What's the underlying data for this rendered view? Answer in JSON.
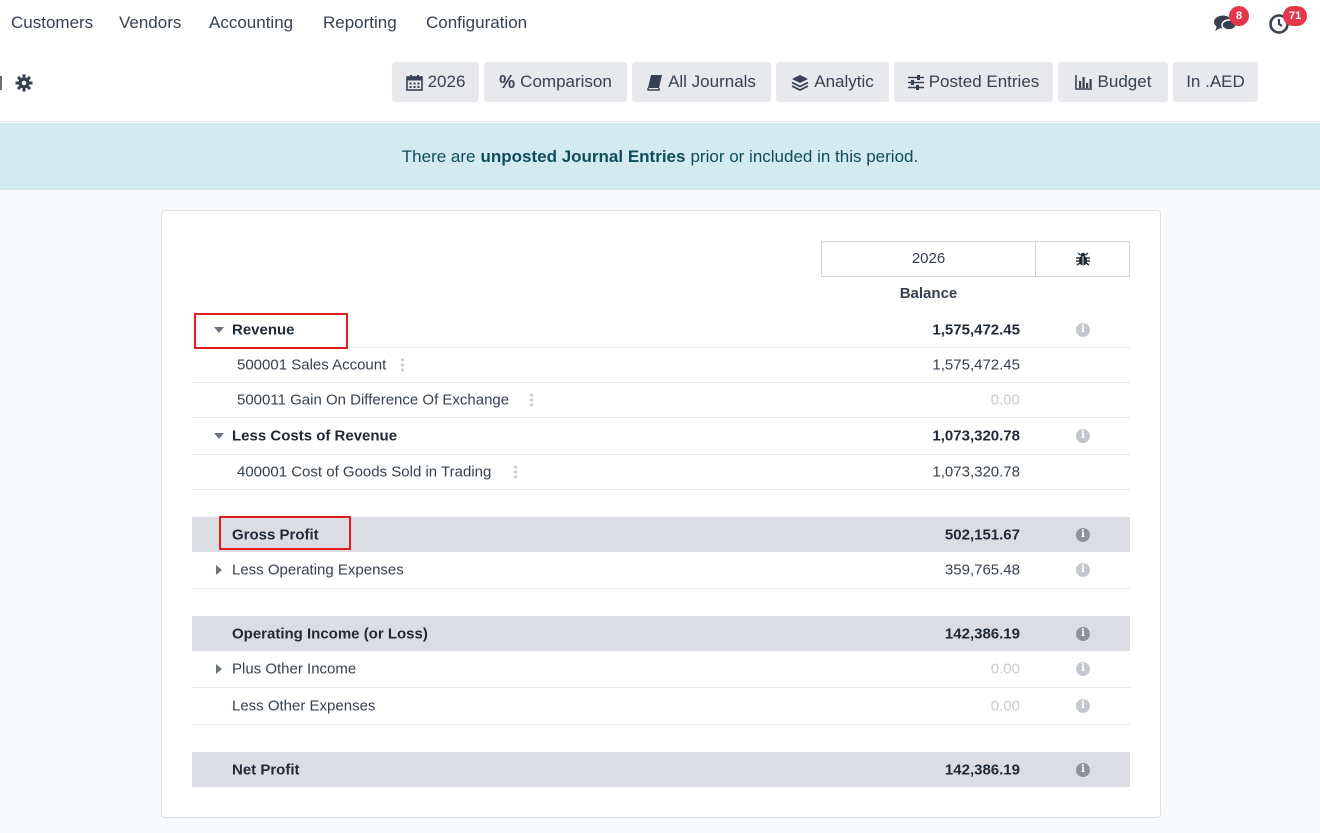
{
  "nav": {
    "menu": [
      "Customers",
      "Vendors",
      "Accounting",
      "Reporting",
      "Configuration"
    ],
    "messages_count": "8",
    "activities_count": "71"
  },
  "filters": {
    "year": "2026",
    "comparison": "Comparison",
    "journals": "All Journals",
    "analytic": "Analytic",
    "posted": "Posted Entries",
    "budget": "Budget",
    "currency": "In .AED"
  },
  "alert": {
    "prefix": "There are",
    "bold": "unposted Journal Entries",
    "suffix": "prior or included in this period."
  },
  "report": {
    "column_year": "2026",
    "column_balance": "Balance",
    "rows": {
      "revenue": {
        "label": "Revenue",
        "value": "1,575,472.45"
      },
      "sales": {
        "label": "500001 Sales Account",
        "value": "1,575,472.45"
      },
      "gain": {
        "label": "500011 Gain On Difference Of Exchange",
        "value": "0.00"
      },
      "costs": {
        "label": "Less Costs of Revenue",
        "value": "1,073,320.78"
      },
      "cogs": {
        "label": "400001 Cost of Goods Sold in Trading",
        "value": "1,073,320.78"
      },
      "gross": {
        "label": "Gross Profit",
        "value": "502,151.67"
      },
      "opex": {
        "label": "Less Operating Expenses",
        "value": "359,765.48"
      },
      "opincome": {
        "label": "Operating Income (or Loss)",
        "value": "142,386.19"
      },
      "otherincome": {
        "label": "Plus Other Income",
        "value": "0.00"
      },
      "otherexp": {
        "label": "Less Other Expenses",
        "value": "0.00"
      },
      "net": {
        "label": "Net Profit",
        "value": "142,386.19"
      }
    }
  },
  "colors": {
    "accent_badge": "#e3384b",
    "alert_bg": "#d2eaf0",
    "total_row_bg": "#dcdde2",
    "highlight_box": "#e11d21"
  }
}
